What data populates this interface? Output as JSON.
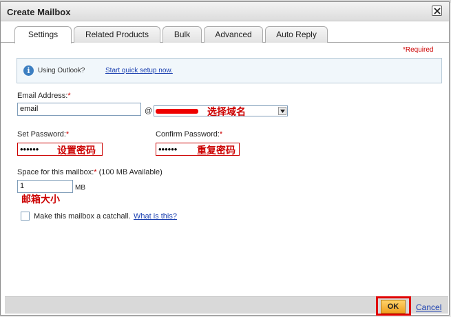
{
  "dialog": {
    "title": "Create Mailbox"
  },
  "tabs": [
    {
      "label": "Settings"
    },
    {
      "label": "Related Products"
    },
    {
      "label": "Bulk"
    },
    {
      "label": "Advanced"
    },
    {
      "label": "Auto Reply"
    }
  ],
  "required_note": "*Required",
  "info": {
    "text": "Using Outlook?",
    "link": "Start quick setup now."
  },
  "email": {
    "label": "Email Address:",
    "value": "email",
    "at": "@",
    "domain_annotation": "选择域名"
  },
  "password": {
    "label": "Set Password:",
    "value": "••••••",
    "annotation": "设置密码"
  },
  "confirm_password": {
    "label": "Confirm Password:",
    "value": "••••••",
    "annotation": "重复密码"
  },
  "space": {
    "label": "Space for this mailbox:",
    "available": "(100 MB Available)",
    "value": "1",
    "unit": "MB",
    "annotation": "邮箱大小"
  },
  "catchall": {
    "label": "Make this mailbox a catchall.",
    "link": "What is this?",
    "checked": false
  },
  "footer": {
    "ok_label": "OK",
    "cancel_label": "Cancel"
  },
  "colors": {
    "annotation_red": "#cc0000",
    "link_blue": "#1a3fb0",
    "ok_orange": "#f0a020"
  }
}
